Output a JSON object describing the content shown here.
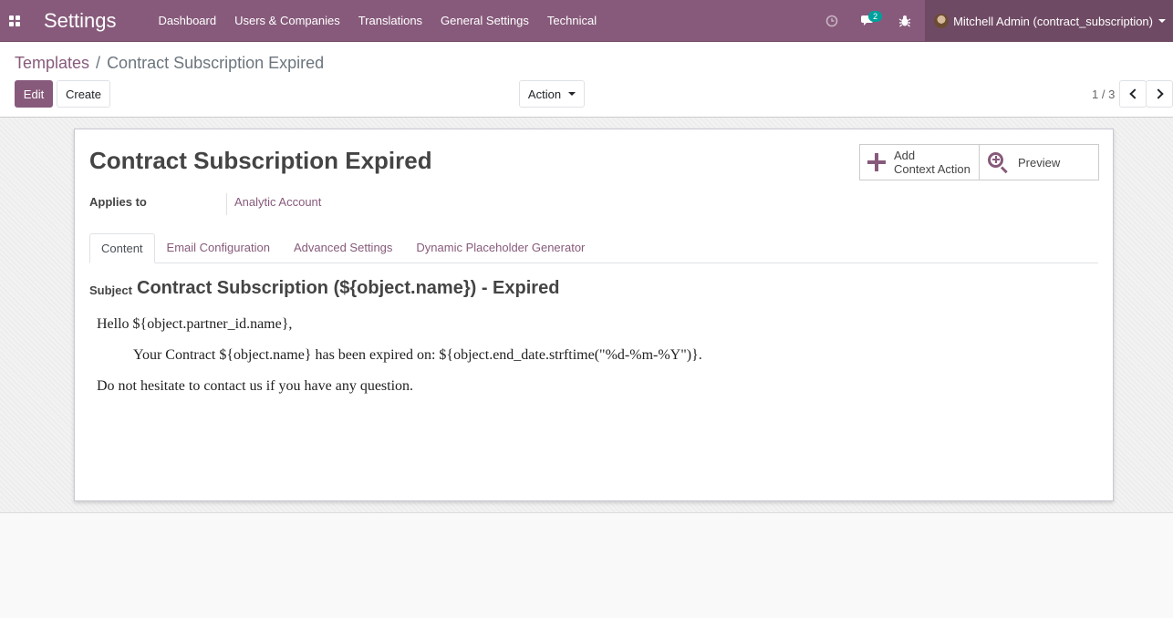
{
  "navbar": {
    "app_name": "Settings",
    "menu": [
      "Dashboard",
      "Users & Companies",
      "Translations",
      "General Settings",
      "Technical"
    ],
    "messages_count": "2",
    "user": "Mitchell Admin (contract_subscription)"
  },
  "breadcrumb": {
    "parent": "Templates",
    "separator": "/",
    "current": "Contract Subscription Expired"
  },
  "buttons": {
    "edit": "Edit",
    "create": "Create",
    "action": "Action"
  },
  "pager": {
    "value": "1 / 3"
  },
  "record": {
    "title": "Contract Subscription Expired",
    "add_context_line1": "Add",
    "add_context_line2": "Context Action",
    "preview": "Preview",
    "applies_to_label": "Applies to",
    "applies_to_value": "Analytic Account"
  },
  "tabs": [
    "Content",
    "Email Configuration",
    "Advanced Settings",
    "Dynamic Placeholder Generator"
  ],
  "content": {
    "subject_label": "Subject",
    "subject_value": "Contract Subscription (${object.name}) - Expired",
    "line1": "Hello ${object.partner_id.name},",
    "line2": "Your Contract ${object.name} has been expired on: ${object.end_date.strftime(\"%d-%m-%Y\")}.",
    "line3": "Do not hesitate to contact us if you have any question."
  },
  "colors": {
    "brand": "#875a7b",
    "badge": "#00a09d"
  }
}
